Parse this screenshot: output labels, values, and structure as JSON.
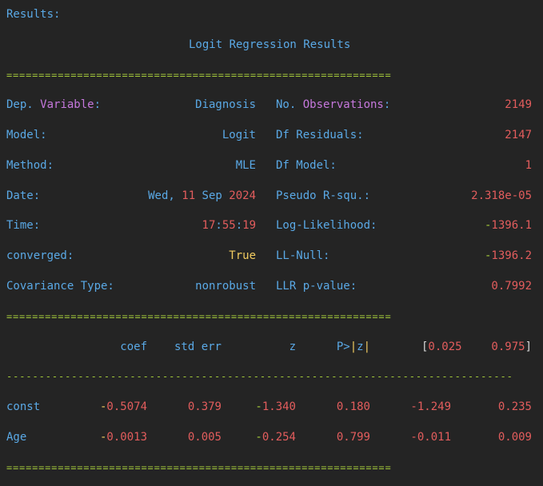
{
  "header": {
    "results_label": "Results:",
    "title": "Logit Regression Results"
  },
  "separators": {
    "double": "============================================================",
    "double_bottom": "============================================================",
    "single": "------------------------------------------------------------------------------"
  },
  "summary": {
    "dep_variable": {
      "label_a": "Dep. ",
      "label_b": "Variable",
      "label_c": ":",
      "value": "Diagnosis"
    },
    "model": {
      "label": "Model:",
      "value": "Logit"
    },
    "method": {
      "label": "Method:",
      "value": "MLE"
    },
    "date": {
      "label": "Date:",
      "value_a": "Wed, ",
      "value_b": "11",
      "value_c": " Sep ",
      "value_d": "2024"
    },
    "time": {
      "label": "Time:",
      "value_a": "17",
      "value_b": ":",
      "value_c": "55",
      "value_d": ":",
      "value_e": "19"
    },
    "converged": {
      "label": "converged:",
      "value": "True"
    },
    "covariance": {
      "label": "Covariance Type:",
      "value": "nonrobust"
    },
    "n_obs": {
      "label_a": "No. ",
      "label_b": "Observations",
      "label_c": ":",
      "value": "2149"
    },
    "df_resid": {
      "label": "Df Residuals:",
      "value": "2147"
    },
    "df_model": {
      "label": "Df Model:",
      "value": "1"
    },
    "pseudo_r2": {
      "label": "Pseudo R-squ.:",
      "value": "2.318e-05"
    },
    "log_likelihood": {
      "label": "Log-Likelihood:",
      "value_sign": "-",
      "value_num": "1396.1"
    },
    "ll_null": {
      "label": "LL-Null:",
      "value_sign": "-",
      "value_num": "1396.2"
    },
    "llr_pvalue": {
      "label": "LLR p-value:",
      "value": "0.7992"
    }
  },
  "coef_table": {
    "headers": {
      "coef": "coef",
      "std_err": "std err",
      "z": "z",
      "p_a": "P>",
      "p_b": "|",
      "p_c": "z",
      "p_d": "|",
      "ci_open": "[",
      "ci_low": "0.025",
      "ci_high": "0.975",
      "ci_close": "]"
    },
    "rows": [
      {
        "name": "const",
        "coef_sign": "-",
        "coef": "0.5074",
        "std_err": "0.379",
        "z_sign": "-",
        "z": "1.340",
        "p": "0.180",
        "ci_low": "-1.249",
        "ci_high": "0.235"
      },
      {
        "name": "Age",
        "coef_sign": "-",
        "coef": "0.0013",
        "std_err": "0.005",
        "z_sign": "-",
        "z": "0.254",
        "p": "0.799",
        "ci_low": "-0.011",
        "ci_high": "0.009"
      }
    ]
  }
}
